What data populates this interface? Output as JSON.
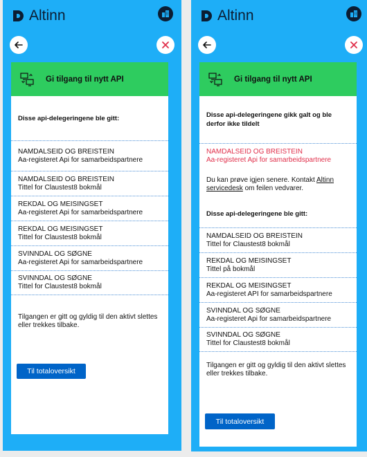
{
  "app": {
    "logo_text": "Altinn"
  },
  "colors": {
    "page_bg": "#1eaef7",
    "header_green": "#2ecc5f",
    "error_red": "#e02e49",
    "primary_button": "#0064c8",
    "logo_dark": "#0b1d33"
  },
  "icons": {
    "back": "arrow-left-icon",
    "close": "close-icon",
    "profile": "building-icon",
    "api": "api-transfer-icon"
  },
  "left": {
    "header_title": "Gi tilgang til nytt API",
    "success_heading": "Disse api-delegeringene ble gitt:",
    "items": [
      {
        "l1": "NAMDALSEID OG BREISTEIN",
        "l2": "Aa-registeret Api for samarbeidspartnere"
      },
      {
        "l1": "NAMDALSEID OG BREISTEIN",
        "l2": "Tittel for Claustest8 bokmål"
      },
      {
        "l1": "REKDAL OG MEISINGSET",
        "l2": "Aa-registeret Api for samarbeidspartnere"
      },
      {
        "l1": "REKDAL OG MEISINGSET",
        "l2": "Tittel for Claustest8 bokmål"
      },
      {
        "l1": "SVINNDAL OG SØGNE",
        "l2": "Aa-registeret Api for samarbeidspartnere"
      },
      {
        "l1": "SVINNDAL OG SØGNE",
        "l2": "Tittel for Claustest8 bokmål"
      }
    ],
    "info_text": "Tilgangen er gitt og gyldig til den aktivt slettes eller trekkes tilbake.",
    "button_label": "Til totaloversikt"
  },
  "right": {
    "header_title": "Gi tilgang til nytt API",
    "failed_heading": "Disse api-delegeringene gikk galt og ble derfor ikke tildelt",
    "failed_items": [
      {
        "l1": "NAMDALSEID OG BREISTEIN",
        "l2": "Aa-registeret Api for samarbeidspartnere"
      }
    ],
    "retry_text_before": "Du kan prøve igjen senere. Kontakt ",
    "retry_link": "Altinn servicedesk",
    "retry_text_after": " om feilen vedvarer.",
    "success_heading": "Disse api-delegeringene ble gitt:",
    "items": [
      {
        "l1": "NAMDALSEID OG BREISTEIN",
        "l2": "Tittel for Claustest8 bokmål"
      },
      {
        "l1": "REKDAL OG MEISINGSET",
        "l2": "Tittel på bokmål"
      },
      {
        "l1": "REKDAL OG MEISINGSET",
        "l2": "Aa-registeret API for samarbeidspartnere"
      },
      {
        "l1": "SVINNDAL OG SØGNE",
        "l2": "Aa-registeret Api for samarbeidspartnere"
      },
      {
        "l1": "SVINNDAL OG SØGNE",
        "l2": "Tittel for Claustest8 bokmål"
      }
    ],
    "info_text": "Tilgangen er gitt og gyldig til den aktivt slettes eller trekkes tilbake.",
    "button_label": "Til totaloversikt"
  }
}
